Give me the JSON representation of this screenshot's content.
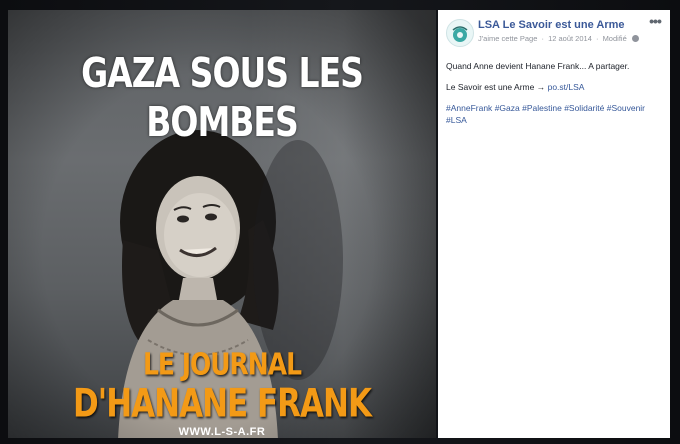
{
  "image": {
    "headline": "GAZA SOUS LES BOMBES",
    "subtitle_line1": "LE JOURNAL",
    "subtitle_line2": "D'HANANE FRANK",
    "site_url": "WWW.L-S-A.FR"
  },
  "post": {
    "page_name": "LSA Le Savoir est une Arme",
    "like_page": "J'aime cette Page",
    "date": "12 août 2014",
    "edited": "Modifié",
    "more_icon": "more-options-icon",
    "text_line1": "Quand Anne devient Hanane Frank... A partager.",
    "text_line2_prefix": "Le Savoir est une Arme →",
    "text_line2_link": "po.st/LSA",
    "hashtags": [
      "#AnneFrank",
      "#Gaza",
      "#Palestine",
      "#Solidarité",
      "#Souvenir",
      "#LSA"
    ]
  },
  "colors": {
    "link": "#365899",
    "accent_orange": "#f39a16",
    "meta_gray": "#90949c"
  }
}
